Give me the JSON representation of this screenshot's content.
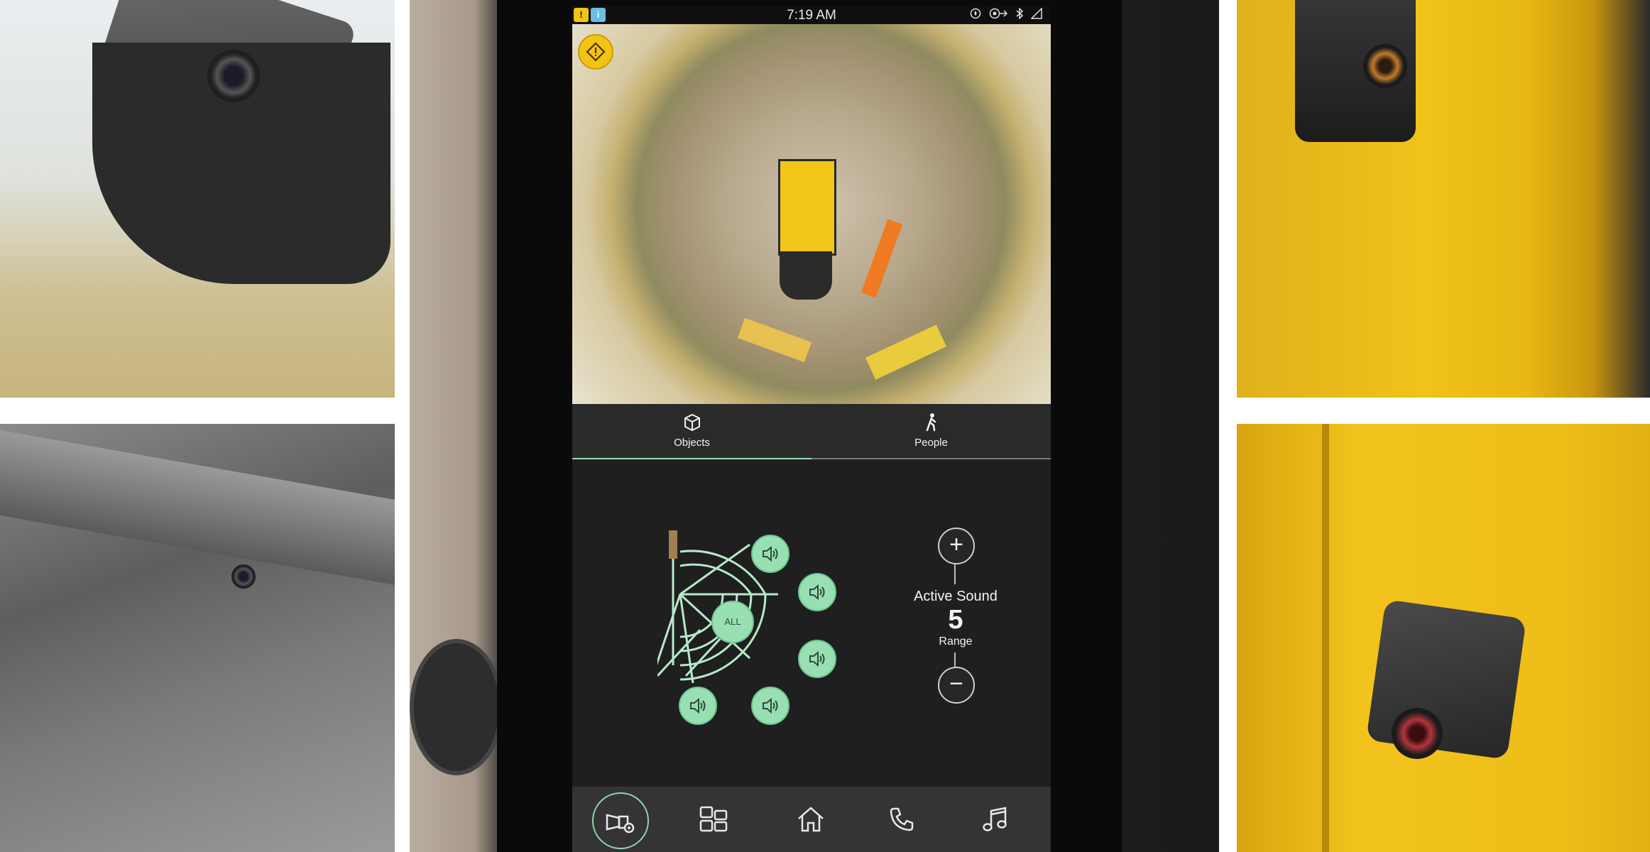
{
  "status_bar": {
    "time": "7:19 AM",
    "badges": [
      {
        "icon": "warning-badge-icon",
        "symbol": "!",
        "color": "#f0c315"
      },
      {
        "icon": "info-badge-icon",
        "symbol": "i",
        "color": "#69bde6"
      }
    ],
    "indicators": [
      "location-icon",
      "turbo-icon",
      "bluetooth-icon",
      "signal-icon"
    ]
  },
  "camera_view": {
    "warning_icon": "warning-diamond-icon",
    "warning_color": "#f0c315"
  },
  "tabs": [
    {
      "label": "Objects",
      "icon": "cube-icon",
      "active": true
    },
    {
      "label": "People",
      "icon": "walking-person-icon",
      "active": false
    }
  ],
  "sound_zones": {
    "all_label": "ALL",
    "zone_icon": "speaker-icon",
    "accent_color": "#98e0b2"
  },
  "range_control": {
    "title": "Active Sound",
    "value": "5",
    "label": "Range",
    "increase_symbol": "+",
    "decrease_symbol": "−"
  },
  "bottom_nav": [
    {
      "icon": "camera-settings-icon",
      "active": true
    },
    {
      "icon": "apps-grid-icon",
      "active": false
    },
    {
      "icon": "home-icon",
      "active": false
    },
    {
      "icon": "phone-icon",
      "active": false
    },
    {
      "icon": "music-icon",
      "active": false
    }
  ]
}
